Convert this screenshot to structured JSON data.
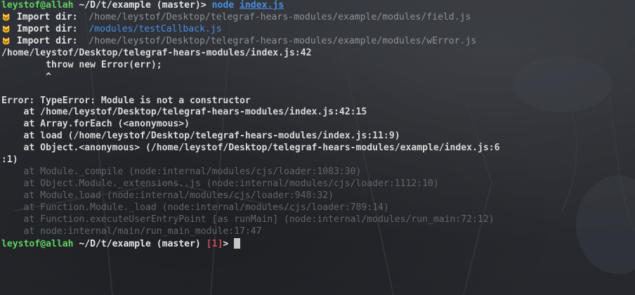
{
  "prompt1": {
    "user_host": "leystof@allah",
    "cwd": "~/D/t/example",
    "branch": "(master)>",
    "command": "node",
    "argument": "index.js"
  },
  "imports": [
    {
      "icon": "cat-face-icon",
      "label": "Import dir:",
      "path": "/home/leystof/Desktop/telegraf-hears-modules/example/modules/field.js"
    },
    {
      "icon": "cat-face-icon",
      "label": "Import dir:",
      "path": "/modules/testCallback.js"
    },
    {
      "icon": "cat-face-icon",
      "label": "Import dir:",
      "path": "/home/leystof/Desktop/telegraf-hears-modules/example/modules/wError.js"
    }
  ],
  "error": {
    "location": "/home/leystof/Desktop/telegraf-hears-modules/index.js:42",
    "code_line": "        throw new Error(err);",
    "caret": "        ^",
    "message": "Error: TypeError: Module is not a constructor",
    "stack": [
      "    at /home/leystof/Desktop/telegraf-hears-modules/index.js:42:15",
      "    at Array.forEach (<anonymous>)",
      "    at load (/home/leystof/Desktop/telegraf-hears-modules/index.js:11:9)",
      "    at Object.<anonymous> (/home/leystof/Desktop/telegraf-hears-modules/example/index.js:6",
      ":1)"
    ],
    "internal_stack": [
      "    at Module._compile (node:internal/modules/cjs/loader:1083:30)",
      "    at Object.Module._extensions..js (node:internal/modules/cjs/loader:1112:10)",
      "    at Module.load (node:internal/modules/cjs/loader:948:32)",
      "    at Function.Module._load (node:internal/modules/cjs/loader:789:14)",
      "    at Function.executeUserEntryPoint [as runMain] (node:internal/modules/run_main:72:12)",
      "    at node:internal/main/run_main_module:17:47"
    ]
  },
  "prompt2": {
    "user_host": "leystof@allah",
    "cwd": "~/D/t/example",
    "branch": "(master)",
    "exit_code": "[1]",
    "symbol": ">"
  },
  "colors": {
    "prompt_green": "#5fd35f",
    "command_blue": "#4a8ee0",
    "error_red": "#d04a5a",
    "dim_gray": "#62656b"
  }
}
